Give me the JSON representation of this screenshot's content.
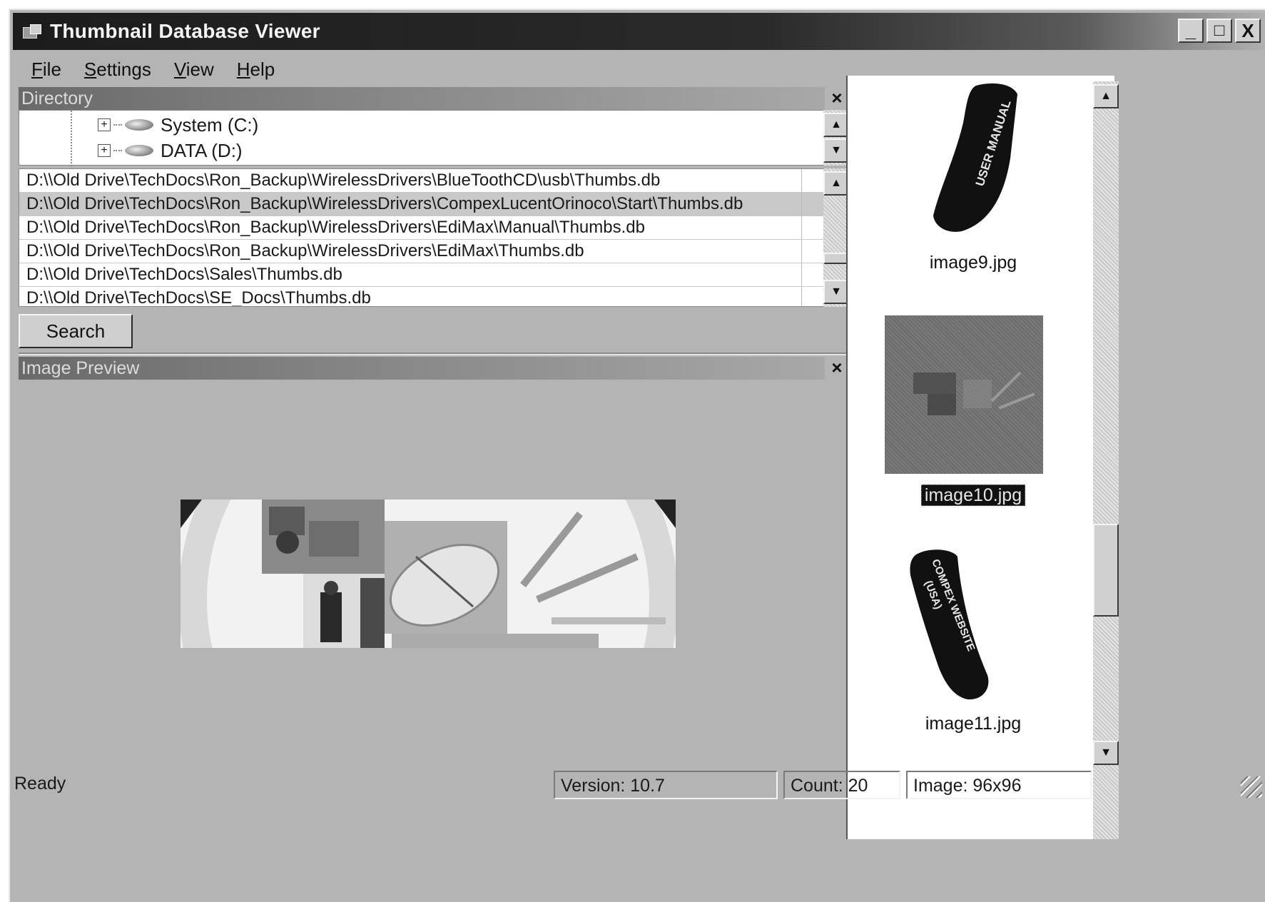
{
  "window": {
    "title": "Thumbnail Database Viewer"
  },
  "title_buttons": {
    "minimize": "_",
    "maximize": "□",
    "close": "X"
  },
  "menu": [
    {
      "first": "F",
      "rest": "ile"
    },
    {
      "first": "S",
      "rest": "ettings"
    },
    {
      "first": "V",
      "rest": "iew"
    },
    {
      "first": "H",
      "rest": "elp"
    }
  ],
  "directory": {
    "title": "Directory",
    "close": "×",
    "drives": [
      "System (C:)",
      "DATA (D:)"
    ],
    "expander": "+"
  },
  "paths": [
    "D:\\\\Old Drive\\TechDocs\\Ron_Backup\\WirelessDrivers\\BlueToothCD\\usb\\Thumbs.db",
    "D:\\\\Old Drive\\TechDocs\\Ron_Backup\\WirelessDrivers\\CompexLucentOrinoco\\Start\\Thumbs.db",
    "D:\\\\Old Drive\\TechDocs\\Ron_Backup\\WirelessDrivers\\EdiMax\\Manual\\Thumbs.db",
    "D:\\\\Old Drive\\TechDocs\\Ron_Backup\\WirelessDrivers\\EdiMax\\Thumbs.db",
    "D:\\\\Old Drive\\TechDocs\\Sales\\Thumbs.db",
    "D:\\\\Old Drive\\TechDocs\\SE_Docs\\Thumbs.db"
  ],
  "selected_path_index": 1,
  "search_button": "Search",
  "preview": {
    "title": "Image Preview",
    "close": "×"
  },
  "thumbnails": [
    {
      "caption": "image9.jpg",
      "label": "USER MANUAL"
    },
    {
      "caption": "image10.jpg",
      "selected": true
    },
    {
      "caption": "image11.jpg",
      "label_lines": [
        "COMPEX WEBSITE",
        "(USA)"
      ]
    }
  ],
  "scroll_arrows": {
    "up": "▲",
    "down": "▼"
  },
  "status": {
    "ready": "Ready",
    "version": "Version: 10.7",
    "count": "Count: 20",
    "image": "Image: 96x96"
  }
}
